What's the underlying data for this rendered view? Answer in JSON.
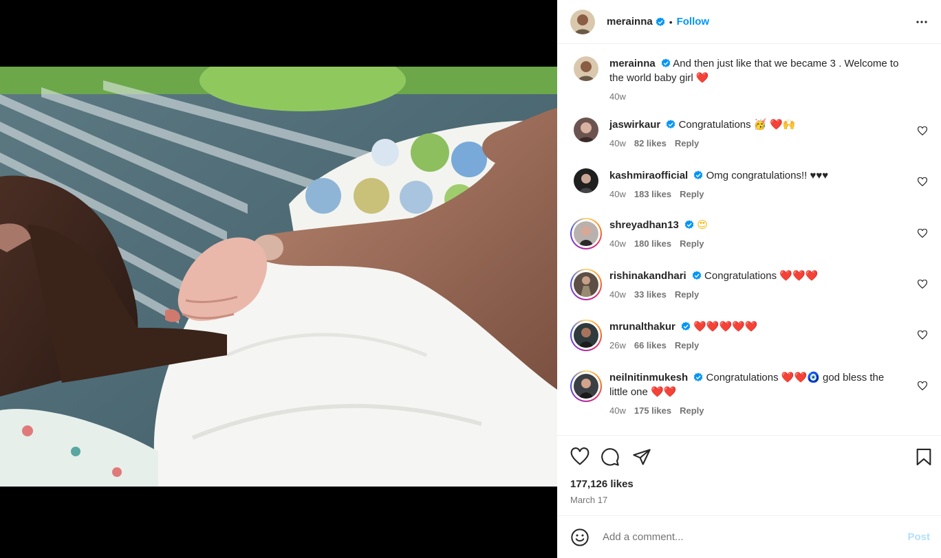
{
  "post": {
    "username": "merainna",
    "follow_label": "Follow",
    "separator": "•",
    "caption": "And then just like that we became 3 . Welcome to the world baby girl",
    "caption_emoji": "❤️",
    "caption_age": "40w",
    "likes": "177,126 likes",
    "date": "March 17"
  },
  "comments": [
    {
      "user": "jaswirkaur",
      "text": "Congratulations",
      "emoji": "🥳 ❤️🙌",
      "age": "40w",
      "likes": "82 likes",
      "reply": "Reply"
    },
    {
      "user": "kashmiraofficial",
      "text": "Omg congratulations!! ♥♥♥",
      "emoji": "",
      "age": "40w",
      "likes": "183 likes",
      "reply": "Reply"
    },
    {
      "user": "shreyadhan13",
      "text": "",
      "emoji": "😍",
      "age": "40w",
      "likes": "180 likes",
      "reply": "Reply"
    },
    {
      "user": "rishinakandhari",
      "text": "Congratulations",
      "emoji": "❤️❤️❤️",
      "age": "40w",
      "likes": "33 likes",
      "reply": "Reply"
    },
    {
      "user": "mrunalthakur",
      "text": "",
      "emoji": "❤️❤️❤️❤️❤️",
      "age": "26w",
      "likes": "66 likes",
      "reply": "Reply"
    },
    {
      "user": "neilnitinmukesh",
      "text": "Congratulations",
      "emoji": "❤️❤️🧿",
      "text2": "god bless the little one",
      "emoji2": "❤️❤️",
      "age": "40w",
      "likes": "175 likes",
      "reply": "Reply"
    }
  ],
  "composer": {
    "placeholder": "Add a comment...",
    "post_label": "Post"
  },
  "icons": {
    "verified": "verified-badge-icon",
    "like": "heart-icon",
    "comment": "comment-icon",
    "share": "share-icon",
    "save": "bookmark-icon",
    "more": "more-horizontal-icon",
    "emoji": "emoji-icon"
  },
  "colors": {
    "accent": "#0095f6",
    "verified": "#0095f6",
    "heart": "#e0162b",
    "muted": "#737373"
  }
}
